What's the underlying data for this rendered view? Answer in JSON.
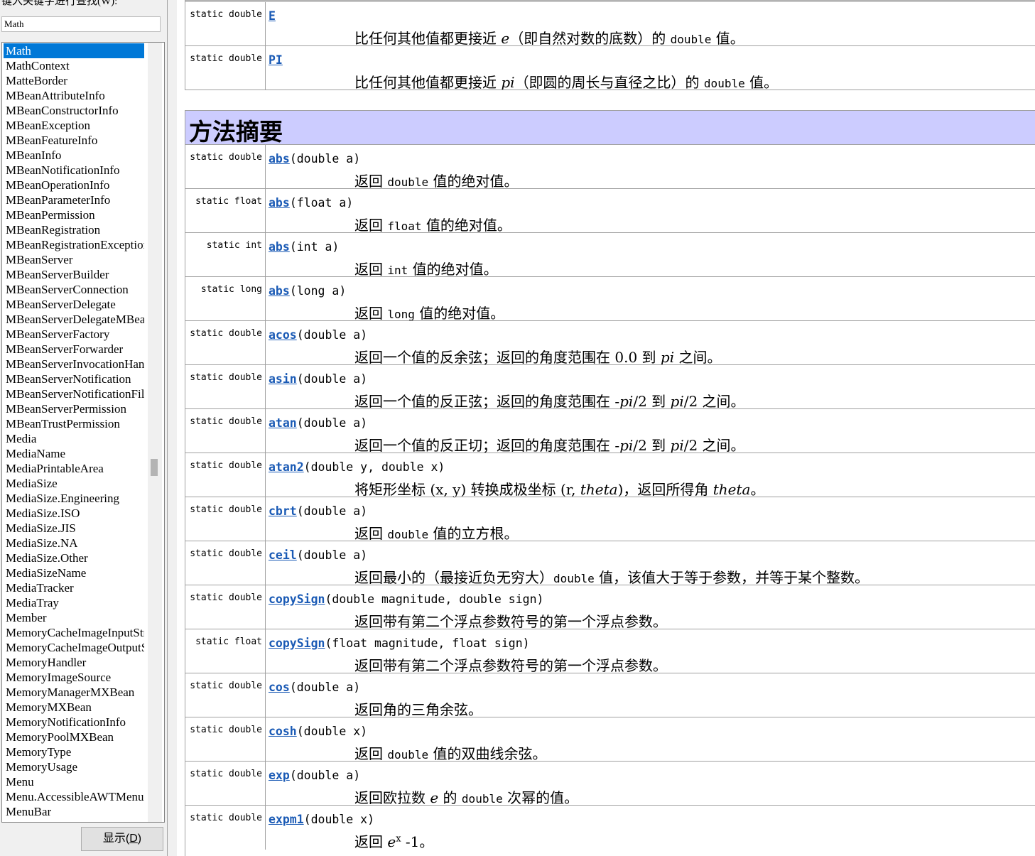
{
  "left_pane": {
    "prompt": "键入关键字进行查找(W):",
    "search_value": "Math",
    "selected": "Math",
    "items": [
      "Math",
      "MathContext",
      "MatteBorder",
      "MBeanAttributeInfo",
      "MBeanConstructorInfo",
      "MBeanException",
      "MBeanFeatureInfo",
      "MBeanInfo",
      "MBeanNotificationInfo",
      "MBeanOperationInfo",
      "MBeanParameterInfo",
      "MBeanPermission",
      "MBeanRegistration",
      "MBeanRegistrationException",
      "MBeanServer",
      "MBeanServerBuilder",
      "MBeanServerConnection",
      "MBeanServerDelegate",
      "MBeanServerDelegateMBean",
      "MBeanServerFactory",
      "MBeanServerForwarder",
      "MBeanServerInvocationHandler",
      "MBeanServerNotification",
      "MBeanServerNotificationFilter",
      "MBeanServerPermission",
      "MBeanTrustPermission",
      "Media",
      "MediaName",
      "MediaPrintableArea",
      "MediaSize",
      "MediaSize.Engineering",
      "MediaSize.ISO",
      "MediaSize.JIS",
      "MediaSize.NA",
      "MediaSize.Other",
      "MediaSizeName",
      "MediaTracker",
      "MediaTray",
      "Member",
      "MemoryCacheImageInputStream",
      "MemoryCacheImageOutputStream",
      "MemoryHandler",
      "MemoryImageSource",
      "MemoryManagerMXBean",
      "MemoryMXBean",
      "MemoryNotificationInfo",
      "MemoryPoolMXBean",
      "MemoryType",
      "MemoryUsage",
      "Menu",
      "Menu.AccessibleAWTMenu",
      "MenuBar"
    ],
    "show_button": "显示(D)"
  },
  "fields": [
    {
      "modifier": "static double",
      "name": "E",
      "params": "",
      "desc": [
        {
          "t": "比任何其他值都更接近 "
        },
        {
          "t": "e",
          "s": "i"
        },
        {
          "t": "（即自然对数的底数）的 "
        },
        {
          "t": "double",
          "s": "m"
        },
        {
          "t": " 值。"
        }
      ]
    },
    {
      "modifier": "static double",
      "name": "PI",
      "params": "",
      "desc": [
        {
          "t": "比任何其他值都更接近 "
        },
        {
          "t": "pi",
          "s": "i"
        },
        {
          "t": "（即圆的周长与直径之比）的 "
        },
        {
          "t": "double",
          "s": "m"
        },
        {
          "t": " 值。"
        }
      ]
    }
  ],
  "method_summary_title": "方法摘要",
  "methods": [
    {
      "modifier": "static double",
      "name": "abs",
      "params": "(double a)",
      "desc": [
        {
          "t": "返回 "
        },
        {
          "t": "double",
          "s": "m"
        },
        {
          "t": " 值的绝对值。"
        }
      ]
    },
    {
      "modifier": "static float",
      "name": "abs",
      "params": "(float a)",
      "desc": [
        {
          "t": "返回 "
        },
        {
          "t": "float",
          "s": "m"
        },
        {
          "t": " 值的绝对值。"
        }
      ]
    },
    {
      "modifier": "static int",
      "name": "abs",
      "params": "(int a)",
      "desc": [
        {
          "t": "返回 "
        },
        {
          "t": "int",
          "s": "m"
        },
        {
          "t": " 值的绝对值。"
        }
      ]
    },
    {
      "modifier": "static long",
      "name": "abs",
      "params": "(long a)",
      "desc": [
        {
          "t": "返回 "
        },
        {
          "t": "long",
          "s": "m"
        },
        {
          "t": " 值的绝对值。"
        }
      ]
    },
    {
      "modifier": "static double",
      "name": "acos",
      "params": "(double a)",
      "desc": [
        {
          "t": "返回一个值的反余弦；返回的角度范围在 0.0 到 "
        },
        {
          "t": "pi",
          "s": "i"
        },
        {
          "t": " 之间。"
        }
      ]
    },
    {
      "modifier": "static double",
      "name": "asin",
      "params": "(double a)",
      "desc": [
        {
          "t": "返回一个值的反正弦；返回的角度范围在 -"
        },
        {
          "t": "pi",
          "s": "i"
        },
        {
          "t": "/2 到 "
        },
        {
          "t": "pi",
          "s": "i"
        },
        {
          "t": "/2 之间。"
        }
      ]
    },
    {
      "modifier": "static double",
      "name": "atan",
      "params": "(double a)",
      "desc": [
        {
          "t": "返回一个值的反正切；返回的角度范围在 -"
        },
        {
          "t": "pi",
          "s": "i"
        },
        {
          "t": "/2 到 "
        },
        {
          "t": "pi",
          "s": "i"
        },
        {
          "t": "/2 之间。"
        }
      ]
    },
    {
      "modifier": "static double",
      "name": "atan2",
      "params": "(double y, double x)",
      "desc": [
        {
          "t": "将矩形坐标 (x, y) 转换成极坐标 (r, "
        },
        {
          "t": "theta",
          "s": "i"
        },
        {
          "t": ")，返回所得角 "
        },
        {
          "t": "theta",
          "s": "i"
        },
        {
          "t": "。"
        }
      ]
    },
    {
      "modifier": "static double",
      "name": "cbrt",
      "params": "(double a)",
      "desc": [
        {
          "t": "返回 "
        },
        {
          "t": "double",
          "s": "m"
        },
        {
          "t": " 值的立方根。"
        }
      ]
    },
    {
      "modifier": "static double",
      "name": "ceil",
      "params": "(double a)",
      "desc": [
        {
          "t": "返回最小的（最接近负无穷大）"
        },
        {
          "t": "double",
          "s": "m"
        },
        {
          "t": " 值，该值大于等于参数，并等于某个整数。"
        }
      ]
    },
    {
      "modifier": "static double",
      "name": "copySign",
      "params": "(double magnitude, double sign)",
      "desc": [
        {
          "t": "返回带有第二个浮点参数符号的第一个浮点参数。"
        }
      ]
    },
    {
      "modifier": "static float",
      "name": "copySign",
      "params": "(float magnitude, float sign)",
      "desc": [
        {
          "t": "返回带有第二个浮点参数符号的第一个浮点参数。"
        }
      ]
    },
    {
      "modifier": "static double",
      "name": "cos",
      "params": "(double a)",
      "desc": [
        {
          "t": "返回角的三角余弦。"
        }
      ]
    },
    {
      "modifier": "static double",
      "name": "cosh",
      "params": "(double x)",
      "desc": [
        {
          "t": "返回 "
        },
        {
          "t": "double",
          "s": "m"
        },
        {
          "t": " 值的双曲线余弦。"
        }
      ]
    },
    {
      "modifier": "static double",
      "name": "exp",
      "params": "(double a)",
      "desc": [
        {
          "t": "返回欧拉数 "
        },
        {
          "t": "e",
          "s": "i"
        },
        {
          "t": " 的 "
        },
        {
          "t": "double",
          "s": "m"
        },
        {
          "t": " 次幂的值。"
        }
      ]
    },
    {
      "modifier": "static double",
      "name": "expm1",
      "params": "(double x)",
      "desc": [
        {
          "t": "返回 "
        },
        {
          "t": "e",
          "s": "i"
        },
        {
          "t": "x",
          "s": "sup"
        },
        {
          "t": " -1。"
        }
      ]
    }
  ]
}
